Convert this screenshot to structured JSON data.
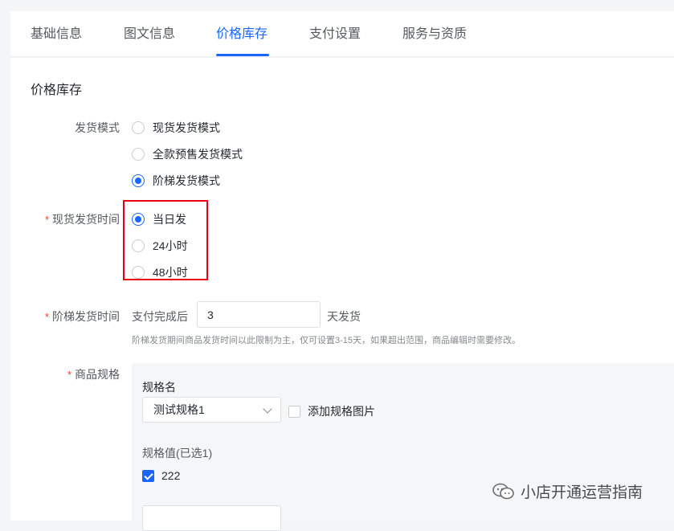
{
  "tabs": [
    {
      "label": "基础信息",
      "active": false
    },
    {
      "label": "图文信息",
      "active": false
    },
    {
      "label": "价格库存",
      "active": true
    },
    {
      "label": "支付设置",
      "active": false
    },
    {
      "label": "服务与资质",
      "active": false
    }
  ],
  "section_title": "价格库存",
  "delivery_mode": {
    "label": "发货模式",
    "options": [
      {
        "label": "现货发货模式",
        "checked": false
      },
      {
        "label": "全款预售发货模式",
        "checked": false
      },
      {
        "label": "阶梯发货模式",
        "checked": true
      }
    ]
  },
  "spot_delivery_time": {
    "required_mark": "*",
    "label": "现货发货时间",
    "options": [
      {
        "label": "当日发",
        "checked": true
      },
      {
        "label": "24小时",
        "checked": false
      },
      {
        "label": "48小时",
        "checked": false
      }
    ]
  },
  "ladder_delivery_time": {
    "required_mark": "*",
    "label": "阶梯发货时间",
    "prefix": "支付完成后",
    "value": "3",
    "suffix": "天发货",
    "hint": "阶梯发货期间商品发货时间以此限制为主，仅可设置3-15天，如果超出范围，商品编辑时需要修改。"
  },
  "spec": {
    "required_mark": "*",
    "label": "商品规格",
    "name_label": "规格名",
    "name_value": "测试规格1",
    "add_image_label": "添加规格图片",
    "add_image_checked": false,
    "values_label": "规格值(已选1)",
    "values": [
      {
        "label": "222",
        "checked": true
      }
    ]
  },
  "watermark": "小店开通运营指南"
}
